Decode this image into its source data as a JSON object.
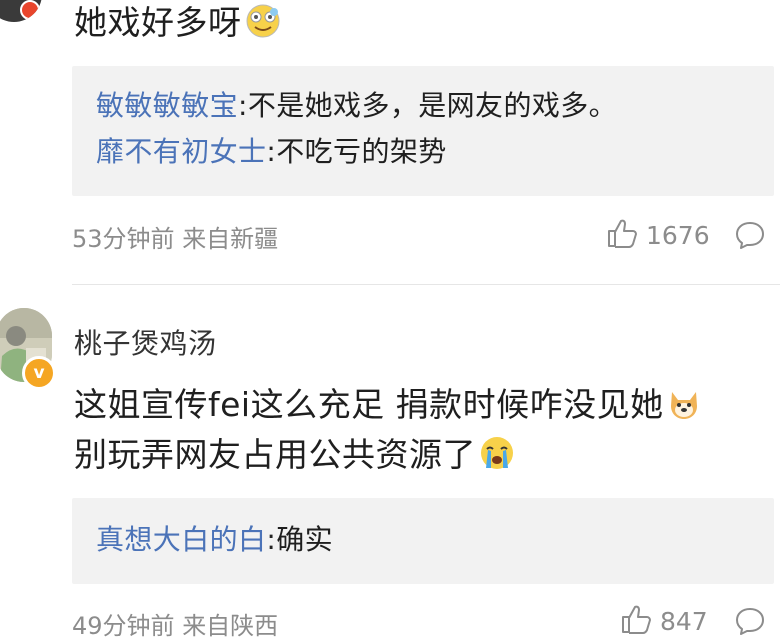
{
  "comment1": {
    "text": "她戏好多呀",
    "emoji": "laugh-cry-emoji",
    "replies": [
      {
        "user": "敏敏敏敏宝",
        "text": "不是她戏多，是网友的戏多。"
      },
      {
        "user": "靡不有初女士",
        "text": "不吃亏的架势"
      }
    ],
    "time": "53分钟前",
    "location": "来自新疆",
    "likes": "1676"
  },
  "comment2": {
    "username": "桃子煲鸡汤",
    "badge": "v",
    "line1": "这姐宣传fei这么充足 捐款时候咋没见她",
    "line1_emoji": "doge-emoji",
    "line2": "别玩弄网友占用公共资源了",
    "line2_emoji": "crying-emoji",
    "replies": [
      {
        "user": "真想大白的白",
        "text": "确实"
      }
    ],
    "time": "49分钟前",
    "location": "来自陕西",
    "likes": "847"
  },
  "colors": {
    "reply_user": "#4b73b8",
    "reply_bg": "#f2f2f2",
    "meta": "#8c8c8c"
  }
}
